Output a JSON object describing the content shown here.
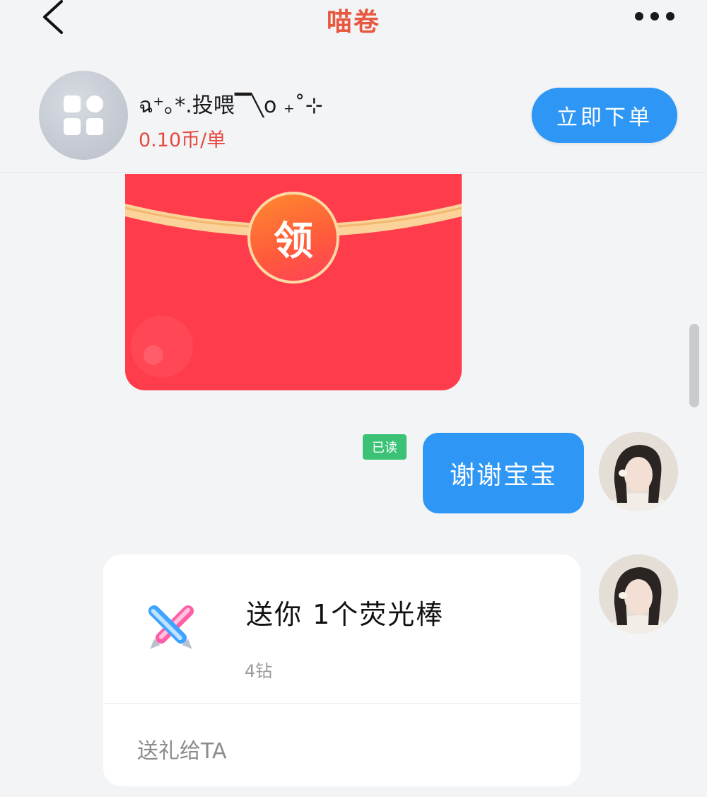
{
  "header": {
    "title": "喵卷",
    "back_icon": "chevron-left-icon",
    "more_icon": "more-dots-icon"
  },
  "service": {
    "avatar_icon": "app-grid-icon",
    "name": "ฉ⁺｡*.投喂▔╲o ₊˚⊹",
    "price": "0.10币/单",
    "order_button": "立即下单"
  },
  "red_packet": {
    "claim_label": "领"
  },
  "messages": {
    "read_status": "已读",
    "my_message": "谢谢宝宝"
  },
  "gift": {
    "title": "送你 1个荧光棒",
    "price": "4钻",
    "action": "送礼给TA"
  },
  "colors": {
    "accent_blue": "#2e96f5",
    "title_red": "#e8573f",
    "price_red": "#e5483f",
    "packet_red": "#ff3c4b",
    "read_green": "#3bc277"
  }
}
